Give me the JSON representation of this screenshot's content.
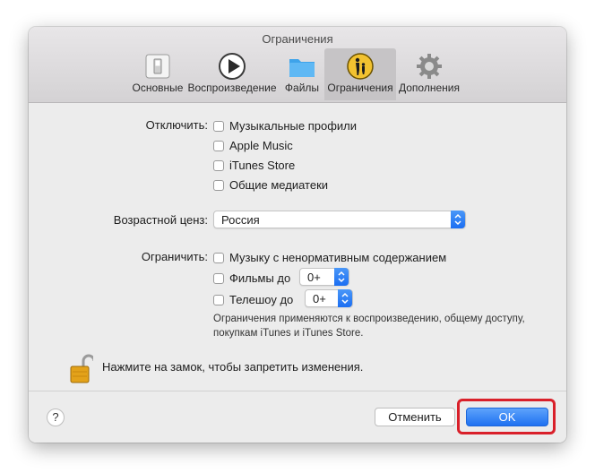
{
  "window": {
    "title": "Ограничения"
  },
  "toolbar": {
    "tabs": [
      {
        "label": "Основные",
        "icon": "switch-icon"
      },
      {
        "label": "Воспроизведение",
        "icon": "play-icon"
      },
      {
        "label": "Файлы",
        "icon": "folder-icon"
      },
      {
        "label": "Ограничения",
        "icon": "parental-controls-icon",
        "selected": true
      },
      {
        "label": "Дополнения",
        "icon": "gear-icon"
      }
    ]
  },
  "disable": {
    "label": "Отключить:",
    "items": [
      {
        "label": "Музыкальные профили",
        "checked": false
      },
      {
        "label": "Apple Music",
        "checked": false
      },
      {
        "label": "iTunes Store",
        "checked": false
      },
      {
        "label": "Общие медиатеки",
        "checked": false
      }
    ]
  },
  "rating": {
    "label": "Возрастной ценз:",
    "value": "Россия"
  },
  "restrict": {
    "label": "Ограничить:",
    "explicit_music": {
      "label": "Музыку с ненормативным содержанием",
      "checked": false
    },
    "movies": {
      "label": "Фильмы до",
      "value": "0+",
      "checked": false
    },
    "tv": {
      "label": "Телешоу до",
      "value": "0+",
      "checked": false
    },
    "note_line1": "Ограничения применяются к воспроизведению, общему доступу,",
    "note_line2": "покупкам iTunes и iTunes Store."
  },
  "lock": {
    "text": "Нажмите на замок, чтобы запретить изменения."
  },
  "footer": {
    "help_label": "?",
    "cancel_label": "Отменить",
    "ok_label": "OK"
  },
  "colors": {
    "accent": "#1f71f1",
    "highlight": "#d9202a",
    "lock": "#e3a21a"
  }
}
